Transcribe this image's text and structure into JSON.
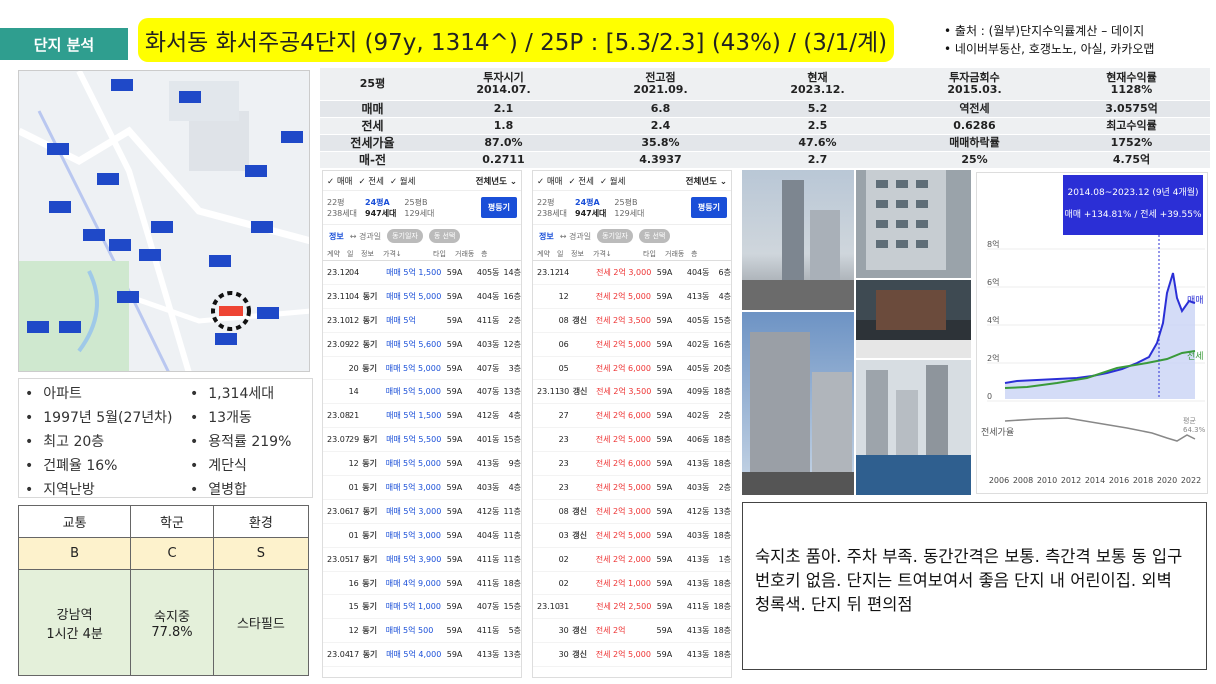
{
  "header": {
    "tag": "단지 분석",
    "title": "화서동 화서주공4단지 (97y, 1314^) / 25P : [5.3/2.3] (43%) / (3/1/계)",
    "sources": [
      "출처 : (월부)단지수익률계산 – 데이지",
      "네이버부동산, 호갱노노, 아실, 카카오맵"
    ]
  },
  "info": {
    "items": [
      "아파트",
      "1,314세대",
      "1997년 5월(27년차)",
      "13개동",
      "최고 20층",
      "용적률 219%",
      "건폐율 16%",
      "계단식",
      "지역난방",
      "열병합"
    ]
  },
  "grade": {
    "headers": [
      "교통",
      "학군",
      "환경"
    ],
    "grades": [
      "B",
      "C",
      "S"
    ],
    "details": [
      "강남역\n1시간 4분",
      "숙지중\n77.8%",
      "스타필드"
    ]
  },
  "summary_table": {
    "rows": [
      [
        "25평",
        "투자시기\n2014.07.",
        "전고점\n2021.09.",
        "현재\n2023.12.",
        "투자금회수\n2015.03.",
        "현재수익률\n1128%"
      ],
      [
        "매매",
        "2.1",
        "6.8",
        "5.2",
        "역전세",
        "3.0575억"
      ],
      [
        "전세",
        "1.8",
        "2.4",
        "2.5",
        "0.6286",
        "최고수익률"
      ],
      [
        "전세가율",
        "87.0%",
        "35.8%",
        "47.6%",
        "매매하락률",
        "1752%"
      ],
      [
        "매-전",
        "0.2711",
        "4.3937",
        "2.7",
        "25%",
        "4.75억"
      ]
    ]
  },
  "panel_left": {
    "filters": [
      "✓ 매매",
      "✓ 전세",
      "✓ 월세"
    ],
    "period": "전체년도 ⌄",
    "sizes": [
      {
        "name": "22평",
        "units": "238세대"
      },
      {
        "name": "24평A",
        "units": "947세대"
      },
      {
        "name": "25평B",
        "units": "129세대"
      }
    ],
    "button": "평등기",
    "tabs": [
      "정보",
      "↔ 경과일"
    ],
    "chips": [
      "동기일자",
      "동 선택"
    ],
    "columns": [
      "계약",
      "일",
      "정보",
      "가격↓",
      "타입",
      "거래동",
      "층"
    ],
    "rows": [
      [
        "23.12",
        "04",
        "",
        "매매 5억 1,500",
        "59A",
        "405동",
        "14층"
      ],
      [
        "23.11",
        "04",
        "동기",
        "매매 5억 5,000",
        "59A",
        "404동",
        "16층"
      ],
      [
        "23.10",
        "12",
        "동기",
        "매매 5억",
        "59A",
        "411동",
        "2층"
      ],
      [
        "23.09",
        "22",
        "동기",
        "매매 5억 5,600",
        "59A",
        "403동",
        "12층"
      ],
      [
        "",
        "20",
        "동기",
        "매매 5억 5,000",
        "59A",
        "407동",
        "3층"
      ],
      [
        "",
        "14",
        "",
        "매매 5억 5,000",
        "59A",
        "407동",
        "13층"
      ],
      [
        "23.08",
        "21",
        "",
        "매매 5억 1,500",
        "59A",
        "412동",
        "4층"
      ],
      [
        "23.07",
        "29",
        "동기",
        "매매 5억 5,500",
        "59A",
        "401동",
        "15층"
      ],
      [
        "",
        "12",
        "동기",
        "매매 5억 5,000",
        "59A",
        "413동",
        "9층"
      ],
      [
        "",
        "01",
        "동기",
        "매매 5억 3,000",
        "59A",
        "403동",
        "4층"
      ],
      [
        "23.06",
        "17",
        "동기",
        "매매 5억 3,000",
        "59A",
        "412동",
        "11층"
      ],
      [
        "",
        "01",
        "동기",
        "매매 5억 3,000",
        "59A",
        "404동",
        "11층"
      ],
      [
        "23.05",
        "17",
        "동기",
        "매매 5억 3,900",
        "59A",
        "411동",
        "11층"
      ],
      [
        "",
        "16",
        "동기",
        "매매 4억 9,000",
        "59A",
        "411동",
        "18층"
      ],
      [
        "",
        "15",
        "동기",
        "매매 5억 1,000",
        "59A",
        "407동",
        "15층"
      ],
      [
        "",
        "12",
        "동기",
        "매매 5억 500",
        "59A",
        "411동",
        "5층"
      ],
      [
        "23.04",
        "17",
        "동기",
        "매매 5억 4,000",
        "59A",
        "413동",
        "13층"
      ]
    ]
  },
  "panel_right": {
    "filters": [
      "✓ 매매",
      "✓ 전세",
      "✓ 월세"
    ],
    "period": "전체년도 ⌄",
    "sizes": [
      {
        "name": "22평",
        "units": "238세대"
      },
      {
        "name": "24평A",
        "units": "947세대"
      },
      {
        "name": "25평B",
        "units": "129세대"
      }
    ],
    "button": "평등기",
    "tabs": [
      "정보",
      "↔ 경과일"
    ],
    "chips": [
      "동기일자",
      "동 선택"
    ],
    "columns": [
      "계약",
      "일",
      "정보",
      "가격↓",
      "타입",
      "거래동",
      "층"
    ],
    "rows": [
      [
        "23.12",
        "14",
        "",
        "전세 2억 3,000",
        "59A",
        "404동",
        "6층"
      ],
      [
        "",
        "12",
        "",
        "전세 2억 5,000",
        "59A",
        "413동",
        "4층"
      ],
      [
        "",
        "08",
        "갱신",
        "전세 2억 3,500",
        "59A",
        "405동",
        "15층"
      ],
      [
        "",
        "06",
        "",
        "전세 2억 5,000",
        "59A",
        "402동",
        "16층"
      ],
      [
        "",
        "05",
        "",
        "전세 2억 6,000",
        "59A",
        "405동",
        "20층"
      ],
      [
        "23.11",
        "30",
        "갱신",
        "전세 2억 3,500",
        "59A",
        "409동",
        "18층"
      ],
      [
        "",
        "27",
        "",
        "전세 2억 6,000",
        "59A",
        "402동",
        "2층"
      ],
      [
        "",
        "23",
        "",
        "전세 2억 5,000",
        "59A",
        "406동",
        "18층"
      ],
      [
        "",
        "23",
        "",
        "전세 2억 6,000",
        "59A",
        "413동",
        "18층"
      ],
      [
        "",
        "23",
        "",
        "전세 2억 5,000",
        "59A",
        "403동",
        "2층"
      ],
      [
        "",
        "08",
        "갱신",
        "전세 2억 3,000",
        "59A",
        "412동",
        "13층"
      ],
      [
        "",
        "03",
        "갱신",
        "전세 2억 5,000",
        "59A",
        "403동",
        "18층"
      ],
      [
        "",
        "02",
        "",
        "전세 2억 2,000",
        "59A",
        "413동",
        "1층"
      ],
      [
        "",
        "02",
        "",
        "전세 2억 1,000",
        "59A",
        "413동",
        "18층"
      ],
      [
        "23.10",
        "31",
        "",
        "전세 2억 2,500",
        "59A",
        "411동",
        "18층"
      ],
      [
        "",
        "30",
        "갱신",
        "전세 2억",
        "59A",
        "413동",
        "18층"
      ],
      [
        "",
        "30",
        "갱신",
        "전세 2억 5,000",
        "59A",
        "413동",
        "18층"
      ]
    ]
  },
  "price_chart": {
    "tooltip_period": "2014.08~2023.12 (9년 4개월)",
    "tooltip_change": "매매 +134.81% / 전세 +39.55%",
    "y_ticks": [
      "8억",
      "6억",
      "4억",
      "2억",
      "0"
    ],
    "x_ticks": [
      "2006",
      "2008",
      "2010",
      "2012",
      "2014",
      "2016",
      "2018",
      "2020",
      "2022"
    ],
    "series_labels": [
      "매매",
      "전세"
    ],
    "ratio_label": "전세가율",
    "ratio_end": "평균\n64.3%",
    "colors": {
      "sale": "#2b2fd6",
      "jeonse": "#3a9a3a",
      "ratio": "#888888"
    }
  },
  "comment": "숙지초 품아. 주차 부족. 동간간격은 보통. 측간격 보통 동 입구 번호키 없음. 단지는 트여보여서 좋음 단지 내 어린이집. 외벽 청록색. 단지 뒤 편의점"
}
